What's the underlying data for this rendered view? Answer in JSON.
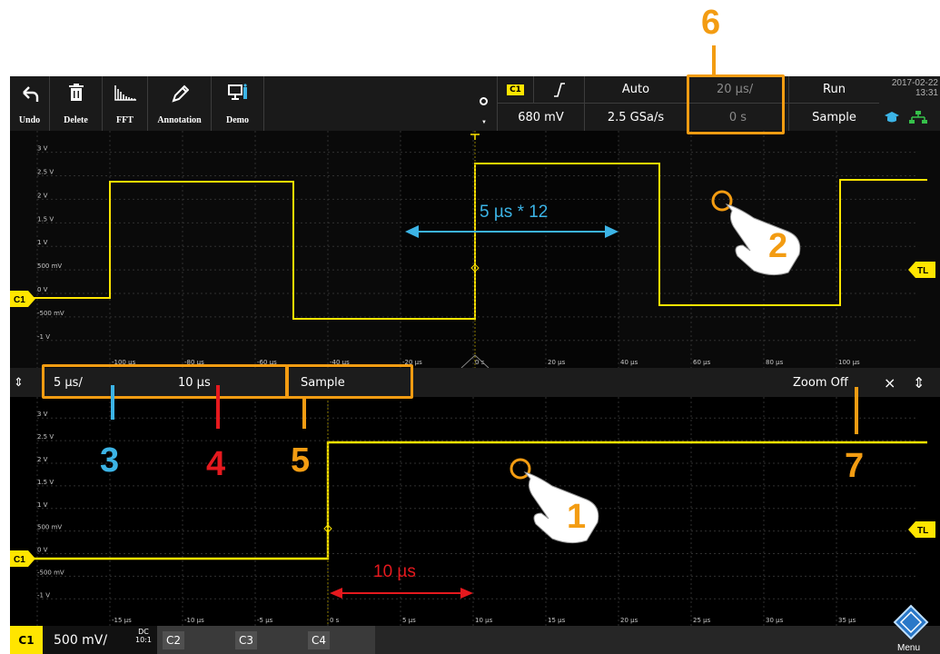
{
  "toolbar": {
    "buttons": [
      {
        "label": "Undo",
        "icon": "undo-icon"
      },
      {
        "label": "Delete",
        "icon": "trash-icon"
      },
      {
        "label": "FFT",
        "icon": "fft-icon"
      },
      {
        "label": "Annotation",
        "icon": "pen-icon"
      },
      {
        "label": "Demo",
        "icon": "demo-icon"
      }
    ],
    "trigger": {
      "source": "C1",
      "edge_icon": "rising-edge-icon",
      "mode": "Auto",
      "level": "680 mV",
      "sample_rate": "2.5 GSa/s"
    },
    "timebase": {
      "scale": "20 µs/",
      "position": "0 s"
    },
    "acquisition": {
      "state": "Run",
      "mode": "Sample"
    },
    "datetime": {
      "date": "2017-02-22",
      "time": "13:31"
    }
  },
  "top_diagram": {
    "y_labels": [
      "3 V",
      "2.5 V",
      "2 V",
      "1.5 V",
      "1 V",
      "500 mV",
      "0 V",
      "-500 mV",
      "-1 V"
    ],
    "x_labels": [
      "-100 µs",
      "-80 µs",
      "-60 µs",
      "-40 µs",
      "-20 µs",
      "0 s",
      "20 µs",
      "40 µs",
      "60 µs",
      "80 µs",
      "100 µs"
    ],
    "channel_marker": "C1",
    "trigger_marker": "TL",
    "annotation": "5 µs * 12"
  },
  "zoom_bar": {
    "scale": "5 µs/",
    "position": "10 µs",
    "mode": "Sample",
    "zoom_off": "Zoom Off",
    "close": "×"
  },
  "bottom_diagram": {
    "y_labels": [
      "3 V",
      "2.5 V",
      "2 V",
      "1.5 V",
      "1 V",
      "500 mV",
      "0 V",
      "-500 mV",
      "-1 V"
    ],
    "x_labels": [
      "-15 µs",
      "-10 µs",
      "-5 µs",
      "0 s",
      "5 µs",
      "10 µs",
      "15 µs",
      "20 µs",
      "25 µs",
      "30 µs",
      "35 µs"
    ],
    "channel_marker": "C1",
    "trigger_marker": "TL",
    "annotation": "10 µs"
  },
  "channels": {
    "c1": "C1",
    "c1_scale": "500 mV/",
    "c1_coupling": "DC",
    "c1_probe": "10:1",
    "c2": "C2",
    "c3": "C3",
    "c4": "C4",
    "menu": "Menu"
  },
  "callouts": [
    "1",
    "2",
    "3",
    "4",
    "5",
    "6",
    "7"
  ],
  "colors": {
    "trace": "#ffe500",
    "orange": "#f39c12",
    "blue": "#3cb4e6",
    "red": "#e6191e"
  }
}
